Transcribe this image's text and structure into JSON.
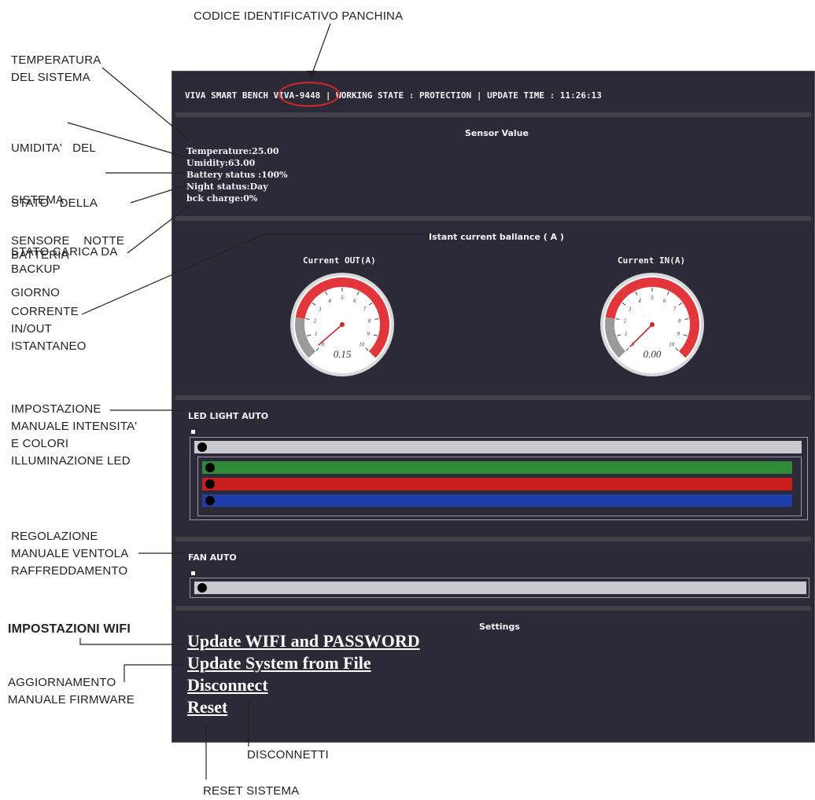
{
  "annotations": {
    "codice": "CODICE IDENTIFICATIVO PANCHINA",
    "temperatura_1": "TEMPERATURA",
    "temperatura_2": "DEL SISTEMA",
    "umidita_1": "UMIDITA'   DEL",
    "umidita_2": "SISTEMA",
    "batteria_1": "STATO   DELLA",
    "batteria_2": "BATTERIA",
    "notte_1": "SENSORE    NOTTE",
    "notte_2": "GIORNO",
    "carica_1": "STATO CARICA DA",
    "carica_2": "BACKUP",
    "corrente_1": "CORRENTE",
    "corrente_2": "IN/OUT",
    "corrente_3": "ISTANTANEO",
    "led_1": "IMPOSTAZIONE",
    "led_2": "MANUALE INTENSITA'",
    "led_3": "E COLORI",
    "led_4": "ILLUMINAZIONE LED",
    "fan_1": "REGOLAZIONE",
    "fan_2": "MANUALE VENTOLA",
    "fan_3": "RAFFREDDAMENTO",
    "wifi": "IMPOSTAZIONI WIFI",
    "fw_1": "AGGIORNAMENTO",
    "fw_2": "MANUALE FIRMWARE",
    "disconnetti": "DISCONNETTI",
    "reset": "RESET SISTEMA"
  },
  "header": {
    "prefix": "VIVA SMART BENCH ",
    "bench_id": "VIVA-9448",
    "suffix": " | WORKING STATE : PROTECTION | UPDATE TIME : 11:26:13"
  },
  "sensor": {
    "title": "Sensor Value",
    "temperature": "Temperature:25.00",
    "humidity": "Umidity:63.00",
    "battery": "Battery status :100%",
    "night": "Night status:Day",
    "bck": "bck charge:0%"
  },
  "current": {
    "title": "Istant current ballance ( A )",
    "out_title": "Current OUT(A)",
    "in_title": "Current IN(A)",
    "out_value": 0.15,
    "out_display": "0.15",
    "in_value": 0.0,
    "in_display": "0.00",
    "gauge_min": 0,
    "gauge_max": 10,
    "ticks": [
      "0",
      "1",
      "2",
      "3",
      "4",
      "5",
      "6",
      "7",
      "8",
      "9",
      "10"
    ]
  },
  "led": {
    "title": "LED LIGHT AUTO",
    "intensity": 0,
    "green": 0,
    "red": 0,
    "blue": 0,
    "colors": {
      "track": "#c9c9cf",
      "green": "#2f8a3a",
      "red": "#c81e1e",
      "blue": "#1f3ea8"
    }
  },
  "fan": {
    "title": "FAN AUTO",
    "speed": 0
  },
  "settings": {
    "title": "Settings",
    "wifi_link": "Update WIFI and PASSWORD",
    "update_link": "Update System from File",
    "disconnect_link": "Disconnect",
    "reset_link": "Reset"
  },
  "colors": {
    "panel": "#2b2a36",
    "separator": "#444247",
    "highlight_circle": "#d0262a",
    "gauge_red": "#e2363b"
  }
}
